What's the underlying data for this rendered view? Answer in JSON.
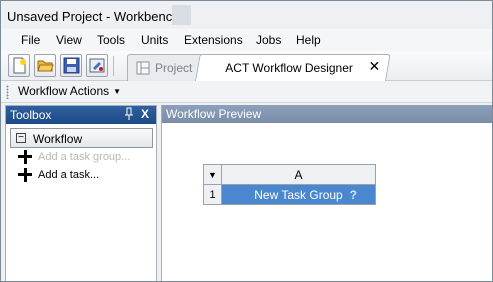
{
  "window": {
    "title": "Unsaved Project - Workbench"
  },
  "menu": {
    "items": [
      "File",
      "View",
      "Tools",
      "Units",
      "Extensions",
      "Jobs",
      "Help"
    ]
  },
  "toolbar": {
    "buttons": [
      "new-icon",
      "open-icon",
      "save-icon",
      "import-icon"
    ],
    "tabs": [
      {
        "label": "Project",
        "icon": "project-icon",
        "active": false
      },
      {
        "label": "ACT Workflow Designer",
        "active": true,
        "close_glyph": "✕"
      }
    ]
  },
  "actions": {
    "label": "Workflow Actions",
    "caret": "▼"
  },
  "toolbox": {
    "title": "Toolbox",
    "pin_glyph": "📌",
    "close_glyph": "X",
    "section": "Workflow",
    "items": [
      {
        "label": "Add a task group...",
        "enabled": false
      },
      {
        "label": "Add a task...",
        "enabled": true
      }
    ]
  },
  "preview": {
    "title": "Workflow Preview",
    "grid": {
      "column_header": "A",
      "row_header": "1",
      "cell_value": "New Task Group",
      "help_glyph": "?",
      "selected_color": "#4a87cf"
    }
  }
}
